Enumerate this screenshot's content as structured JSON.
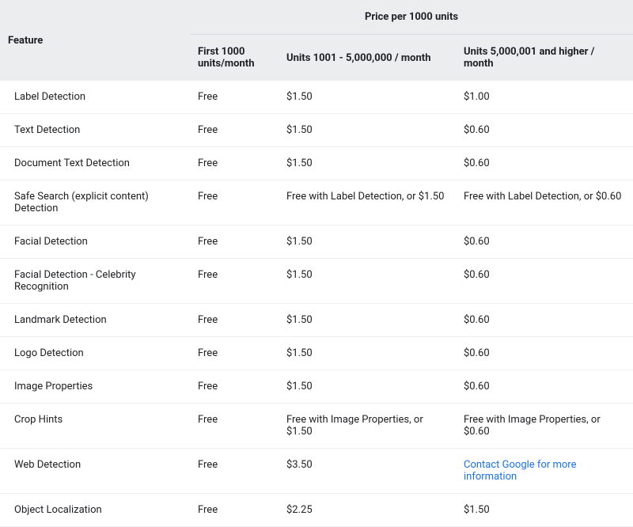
{
  "header": {
    "feature": "Feature",
    "price_per": "Price per 1000 units",
    "tier1": "First 1000 units/month",
    "tier2": "Units 1001 - 5,000,000 / month",
    "tier3": "Units 5,000,001 and higher / month"
  },
  "rows": [
    {
      "feature": "Label Detection",
      "tier1": "Free",
      "tier2": "$1.50",
      "tier3": "$1.00"
    },
    {
      "feature": "Text Detection",
      "tier1": "Free",
      "tier2": "$1.50",
      "tier3": "$0.60"
    },
    {
      "feature": "Document Text Detection",
      "tier1": "Free",
      "tier2": "$1.50",
      "tier3": "$0.60"
    },
    {
      "feature": "Safe Search (explicit content) Detection",
      "tier1": "Free",
      "tier2": "Free with Label Detection, or $1.50",
      "tier3": "Free with Label Detection, or $0.60"
    },
    {
      "feature": "Facial Detection",
      "tier1": "Free",
      "tier2": "$1.50",
      "tier3": "$0.60"
    },
    {
      "feature": "Facial Detection - Celebrity Recognition",
      "tier1": "Free",
      "tier2": "$1.50",
      "tier3": "$0.60"
    },
    {
      "feature": "Landmark Detection",
      "tier1": "Free",
      "tier2": "$1.50",
      "tier3": "$0.60"
    },
    {
      "feature": "Logo Detection",
      "tier1": "Free",
      "tier2": "$1.50",
      "tier3": "$0.60"
    },
    {
      "feature": "Image Properties",
      "tier1": "Free",
      "tier2": "$1.50",
      "tier3": "$0.60"
    },
    {
      "feature": "Crop Hints",
      "tier1": "Free",
      "tier2": "Free with Image Properties, or $1.50",
      "tier3": "Free with Image Properties, or $0.60"
    },
    {
      "feature": "Web Detection",
      "tier1": "Free",
      "tier2": "$3.50",
      "tier3": "Contact Google for more information",
      "tier3_link": true
    },
    {
      "feature": "Object Localization",
      "tier1": "Free",
      "tier2": "$2.25",
      "tier3": "$1.50"
    }
  ]
}
